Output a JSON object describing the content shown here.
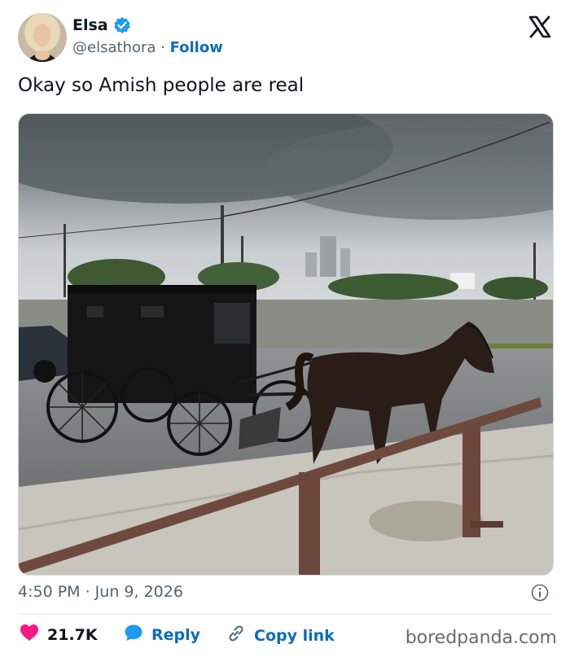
{
  "author": {
    "name": "Elsa",
    "handle": "@elsathora",
    "separator": " · ",
    "follow_label": "Follow",
    "verified_icon": "verified-badge-icon",
    "avatar_icon": "user-avatar"
  },
  "brand_icon": "x-logo-icon",
  "tweet": {
    "text": "Okay so Amish people are real",
    "timestamp": "4:50 PM · Jun 9, 2026"
  },
  "actions": {
    "likes_count": "21.7K",
    "reply_label": "Reply",
    "copy_link_label": "Copy link"
  },
  "watermark": "boredpanda.com",
  "colors": {
    "link_blue": "#0a6cc2",
    "heart_red": "#f91880",
    "verified_blue": "#1d9bf0",
    "muted_text": "#536471"
  }
}
